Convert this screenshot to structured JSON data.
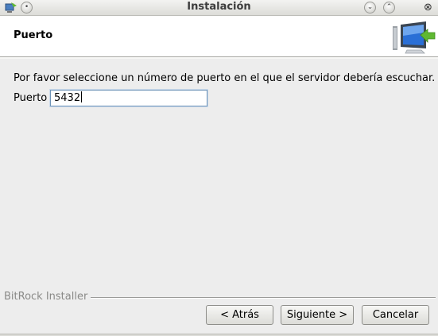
{
  "window": {
    "title": "Instalación"
  },
  "header": {
    "title": "Puerto",
    "icon": "installer-monitor-icon"
  },
  "main": {
    "instruction": "Por favor seleccione un número de puerto en el que el servidor debería escuchar.",
    "port_label": "Puerto",
    "port_value": "5432"
  },
  "footer": {
    "brand": "BitRock Installer",
    "back_label": "< Atrás",
    "next_label": "Siguiente >",
    "cancel_label": "Cancelar"
  },
  "colors": {
    "window_bg": "#ededed",
    "header_bg": "#ffffff",
    "input_border": "#6f94b8",
    "icon_green": "#5fb832",
    "icon_blue": "#2a6fd6"
  }
}
